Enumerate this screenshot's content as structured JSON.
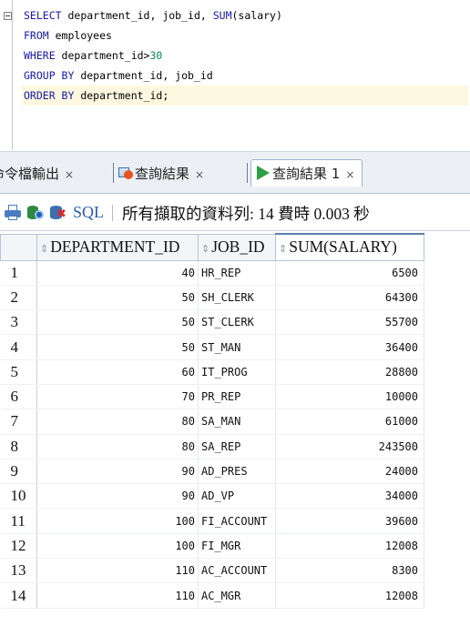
{
  "editor": {
    "lines": [
      {
        "parts": [
          [
            "kw",
            "SELECT"
          ],
          [
            "t",
            " department_id, job_id, "
          ],
          [
            "fn",
            "SUM"
          ],
          [
            "t",
            "(salary)"
          ]
        ]
      },
      {
        "parts": [
          [
            "kw",
            "FROM"
          ],
          [
            "t",
            " employees"
          ]
        ]
      },
      {
        "parts": [
          [
            "kw",
            "WHERE"
          ],
          [
            "t",
            " department_id>"
          ],
          [
            "num",
            "30"
          ]
        ]
      },
      {
        "parts": [
          [
            "kw",
            "GROUP BY"
          ],
          [
            "t",
            " department_id, job_id"
          ]
        ]
      },
      {
        "parts": [
          [
            "kw",
            "ORDER BY"
          ],
          [
            "t",
            " department_id;"
          ]
        ]
      }
    ]
  },
  "tabs": {
    "script_output": "命令檔輸出",
    "query_result_1": "查詢結果",
    "query_result_2": "查詢結果 1",
    "close": "×"
  },
  "toolbar": {
    "sql_label": "SQL",
    "status": "所有擷取的資料列: 14 費時 0.003 秒"
  },
  "grid": {
    "columns": [
      "DEPARTMENT_ID",
      "JOB_ID",
      "SUM(SALARY)"
    ],
    "rows": [
      [
        "1",
        "40",
        "HR_REP",
        "6500"
      ],
      [
        "2",
        "50",
        "SH_CLERK",
        "64300"
      ],
      [
        "3",
        "50",
        "ST_CLERK",
        "55700"
      ],
      [
        "4",
        "50",
        "ST_MAN",
        "36400"
      ],
      [
        "5",
        "60",
        "IT_PROG",
        "28800"
      ],
      [
        "6",
        "70",
        "PR_REP",
        "10000"
      ],
      [
        "7",
        "80",
        "SA_MAN",
        "61000"
      ],
      [
        "8",
        "80",
        "SA_REP",
        "243500"
      ],
      [
        "9",
        "90",
        "AD_PRES",
        "24000"
      ],
      [
        "10",
        "90",
        "AD_VP",
        "34000"
      ],
      [
        "11",
        "100",
        "FI_ACCOUNT",
        "39600"
      ],
      [
        "12",
        "100",
        "FI_MGR",
        "12008"
      ],
      [
        "13",
        "110",
        "AC_ACCOUNT",
        "8300"
      ],
      [
        "14",
        "110",
        "AC_MGR",
        "12008"
      ]
    ]
  },
  "icons": {
    "print": "printer-icon",
    "db": "database-refresh-icon",
    "dbx": "database-delete-icon",
    "sort": "sort-icon"
  },
  "colors": {
    "keyword": "#1a1aa6",
    "number": "#09885a",
    "run_green": "#2ea043",
    "active_line": "#fcf8df"
  }
}
